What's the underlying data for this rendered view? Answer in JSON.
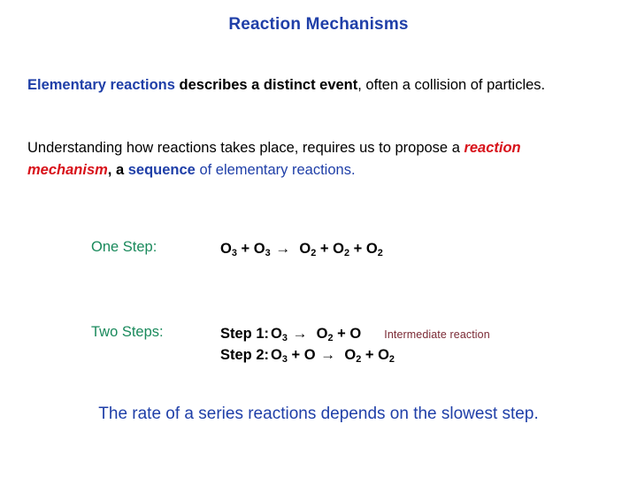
{
  "slide": {
    "title": "Reaction Mechanisms",
    "colors": {
      "title_blue": "#1f3fa8",
      "body_black": "#000000",
      "emphasis_red": "#d8121a",
      "label_green": "#1a8a5c",
      "note_maroon": "#7b2a35",
      "background": "#ffffff"
    },
    "paragraphs": [
      {
        "id": "elementary-reactions",
        "runs": [
          {
            "text": "Elementary reactions",
            "style": "bold-blue"
          },
          {
            "text": " describes a distinct event",
            "style": "bold-black"
          },
          {
            "text": ", often a collision of particles.",
            "style": "normal-black"
          }
        ]
      },
      {
        "id": "reaction-mechanism",
        "runs": [
          {
            "text": "Understanding how reactions takes place, requires us to propose a ",
            "style": "normal-black"
          },
          {
            "text": "reaction mechanism",
            "style": "bold-italic-red"
          },
          {
            "text": ", a ",
            "style": "bold-black"
          },
          {
            "text": "sequence",
            "style": "bold-blue"
          },
          {
            "text": " of elementary reactions.",
            "style": "normal-blue"
          }
        ]
      }
    ],
    "mechanisms": [
      {
        "id": "one-step",
        "label": "One Step:",
        "lines": [
          {
            "step_label": "",
            "reactants": {
              "a": "O",
              "a_sub": "3",
              "op": "+",
              "b": "O",
              "b_sub": "3"
            },
            "arrow": "→",
            "products": [
              {
                "sym": "O",
                "sub": "2"
              },
              {
                "sym": "O",
                "sub": "2"
              },
              {
                "sym": "O",
                "sub": "2"
              }
            ],
            "note": ""
          }
        ]
      },
      {
        "id": "two-steps",
        "label": "Two Steps:",
        "lines": [
          {
            "step_label": "Step 1:",
            "reactants_text": "O3",
            "arrow": "→",
            "products_text": "O2 + O",
            "note": "Intermediate reaction"
          },
          {
            "step_label": "Step 2:",
            "reactants_text": "O3 + O",
            "arrow": "→",
            "products_text": "O2 + O2",
            "note": ""
          }
        ]
      }
    ],
    "closing": "The rate of a series reactions depends on the slowest step."
  }
}
